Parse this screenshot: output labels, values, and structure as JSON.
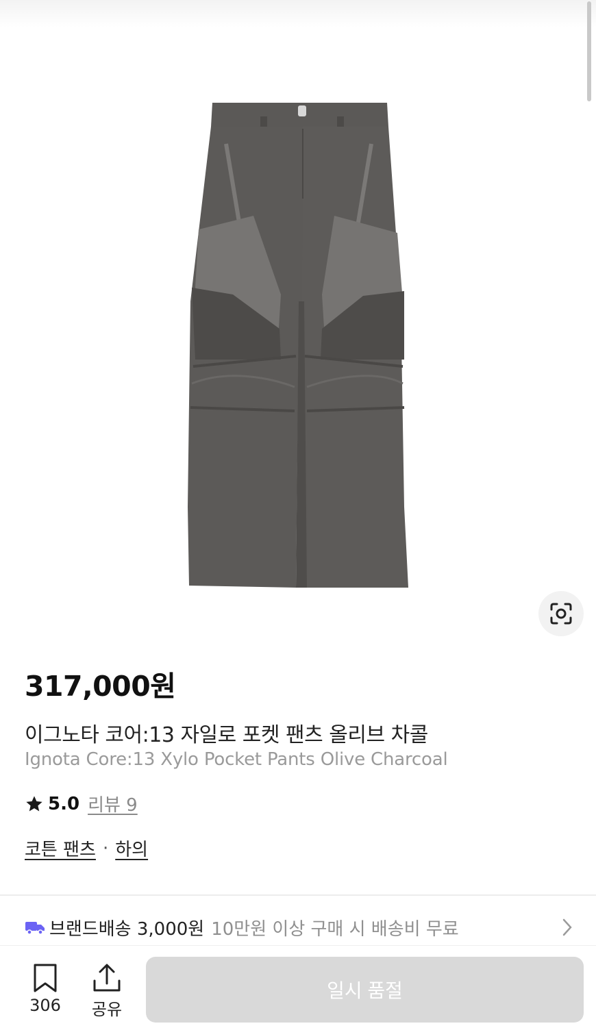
{
  "product": {
    "price": "317,000원",
    "name_ko": "이그노타 코어:13 자일로 포켓 팬츠 올리브 차콜",
    "name_en": "Ignota Core:13 Xylo Pocket Pants Olive Charcoal",
    "rating": "5.0",
    "review_label": "리뷰 9",
    "category_1": "코튼 팬츠",
    "category_separator": "·",
    "category_2": "하의"
  },
  "shipping": {
    "label": "브랜드배송 3,000원",
    "note": "10만원 이상 구매 시 배송비 무료"
  },
  "bottom_bar": {
    "bookmark_count": "306",
    "share_label": "공유",
    "soldout_label": "일시 품절"
  },
  "icons": {
    "lens": "lens-icon",
    "truck": "truck-icon",
    "chevron": "chevron-right-icon",
    "bookmark": "bookmark-icon",
    "share": "share-icon",
    "star": "star-icon"
  },
  "colors": {
    "truck": "#6b63f4",
    "pants": "#5a5856",
    "soldout_bg": "#d9d9d9"
  }
}
